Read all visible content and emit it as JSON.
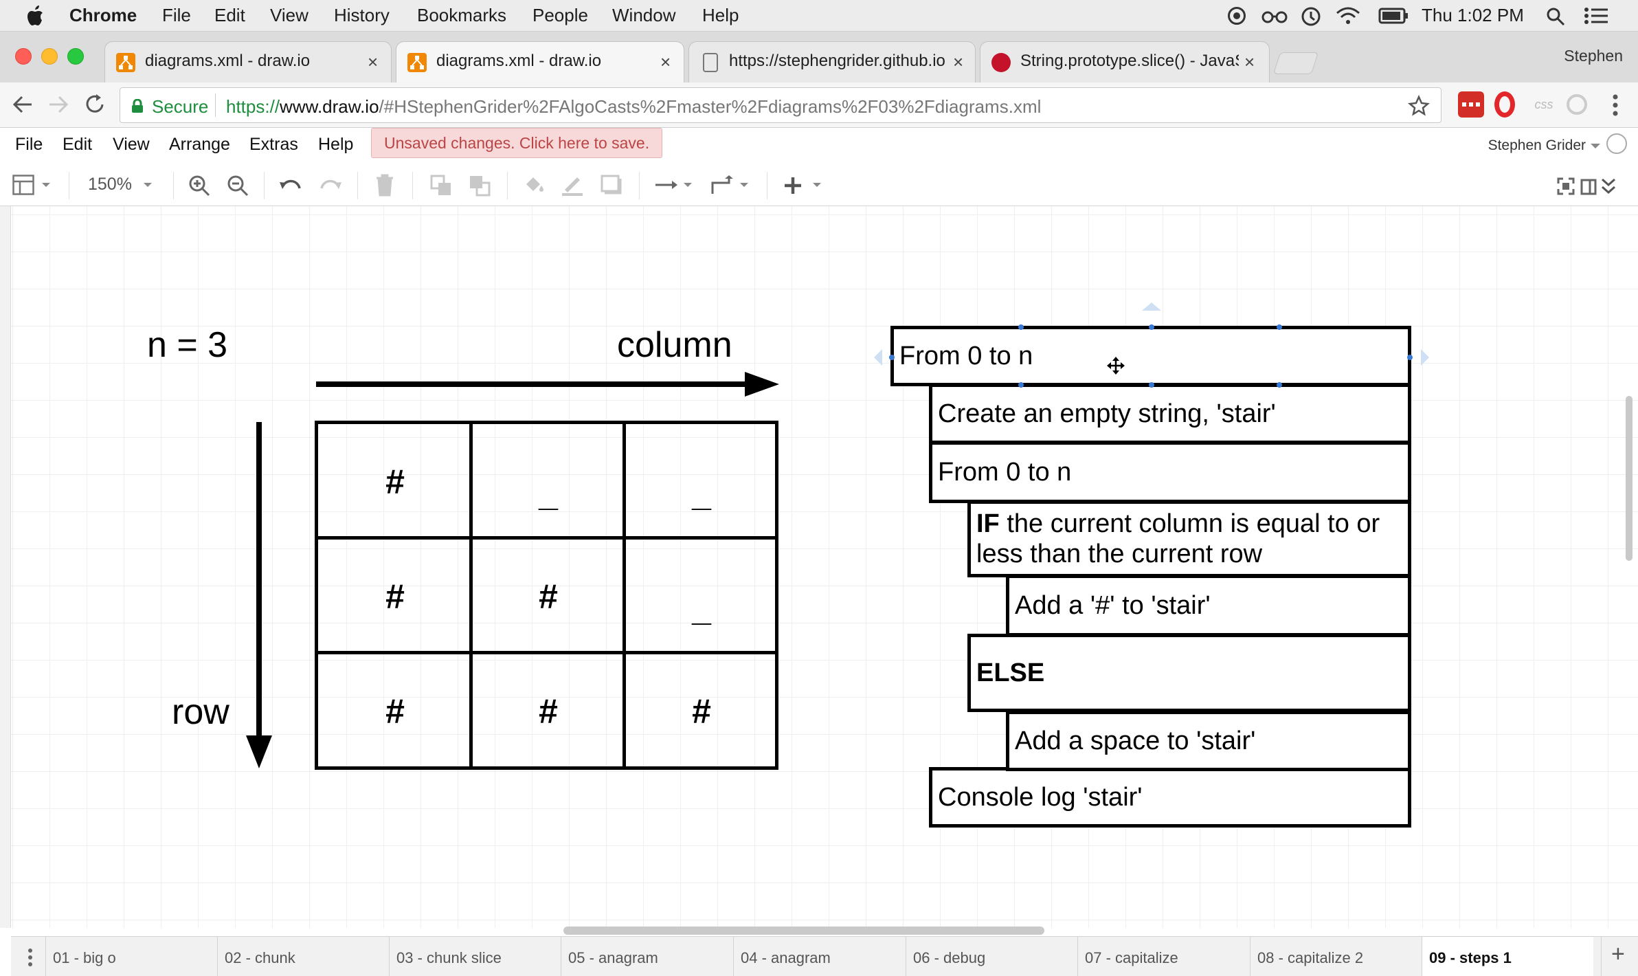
{
  "mac_menubar": {
    "apple_icon": "apple-logo",
    "app_name": "Chrome",
    "menus": [
      "File",
      "Edit",
      "View",
      "History",
      "Bookmarks",
      "People",
      "Window",
      "Help"
    ],
    "clock": "Thu 1:02 PM",
    "status_icons": [
      "record-icon",
      "glasses-icon",
      "time-machine-icon",
      "wifi-icon",
      "battery-icon",
      "spotlight-icon",
      "notification-center-icon"
    ]
  },
  "browser": {
    "tabs": [
      {
        "title": "diagrams.xml - draw.io",
        "favicon": "drawio-icon",
        "active": false
      },
      {
        "title": "diagrams.xml - draw.io",
        "favicon": "drawio-icon",
        "active": true
      },
      {
        "title": "https://stephengrider.github.io",
        "favicon": "document-icon",
        "active": false
      },
      {
        "title": "String.prototype.slice() - JavaS",
        "favicon": "mdn-icon",
        "active": false
      }
    ],
    "close_glyph": "×",
    "profile_name": "Stephen",
    "secure_label": "Secure",
    "url_scheme": "https://",
    "url_host": "www.draw.io",
    "url_path": "/#HStephenGrider%2FAlgoCasts%2Fmaster%2Fdiagrams%2F03%2Fdiagrams.xml",
    "extension_icons": [
      "lastpass-icon",
      "opera-icon",
      "css-icon",
      "extension-icon"
    ]
  },
  "drawio": {
    "menu": [
      "File",
      "Edit",
      "View",
      "Arrange",
      "Extras",
      "Help"
    ],
    "unsaved_banner": "Unsaved changes. Click here to save.",
    "user_name": "Stephen Grider",
    "zoom": "150%",
    "toolbar_icons": [
      "format-panel-icon",
      "zoom-in-icon",
      "zoom-out-icon",
      "undo-icon",
      "redo-icon",
      "delete-icon",
      "to-front-icon",
      "to-back-icon",
      "fill-color-icon",
      "line-color-icon",
      "shadow-icon",
      "connection-icon",
      "waypoints-icon",
      "insert-icon",
      "fullscreen-icon",
      "toggle-panel-icon",
      "collapse-icon"
    ],
    "diagram": {
      "n_label": "n = 3",
      "column_label": "column",
      "row_label": "row",
      "grid": [
        [
          "#",
          "_",
          "_"
        ],
        [
          "#",
          "#",
          "_"
        ],
        [
          "#",
          "#",
          "#"
        ]
      ],
      "pseudocode": {
        "step1": "From 0 to n",
        "step2": "Create an empty string, 'stair'",
        "step3": "From 0 to n",
        "step4_keyword": "IF",
        "step4_text": " the current column is equal to or less than the current row",
        "step5": "Add a '#' to 'stair'",
        "step6": "ELSE",
        "step7": "Add a space to 'stair'",
        "step8": "Console log 'stair'"
      }
    },
    "pages": [
      "01 - big o",
      "02 - chunk",
      "03 - chunk slice",
      "05 - anagram",
      "04 - anagram",
      "06 - debug",
      "07 - capitalize",
      "08 - capitalize 2",
      "09 - steps 1"
    ],
    "active_page": "09 - steps 1",
    "add_page_glyph": "+"
  }
}
